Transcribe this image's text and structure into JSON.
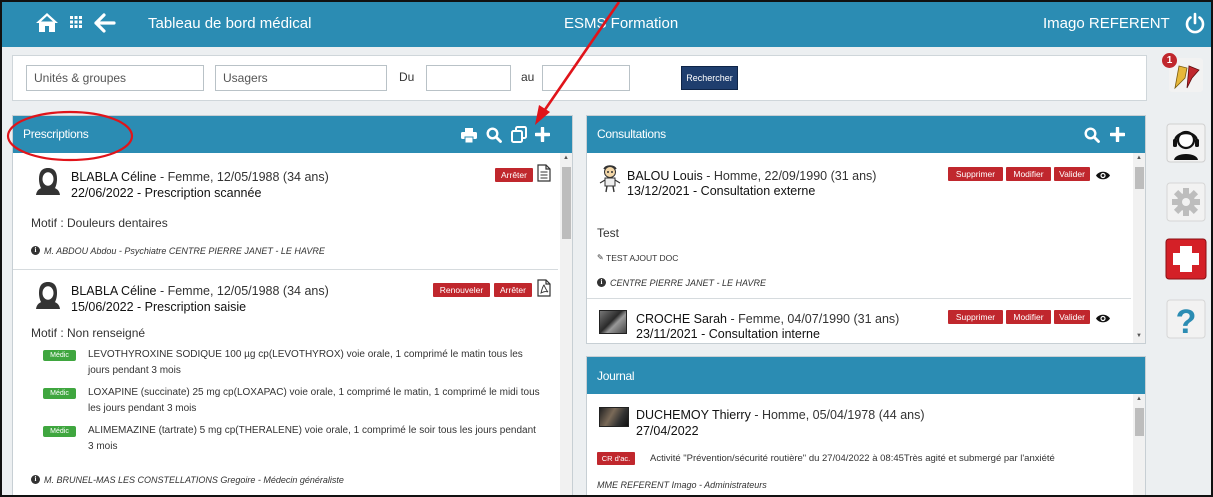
{
  "header": {
    "title": "Tableau de bord médical",
    "org": "ESMS Formation",
    "user": "Imago REFERENT"
  },
  "filters": {
    "units_placeholder": "Unités & groupes",
    "users_placeholder": "Usagers",
    "from_label": "Du",
    "to_label": "au",
    "search_label": "Rechercher"
  },
  "prescriptions": {
    "title": "Prescriptions",
    "entries": [
      {
        "name": "BLABLA Céline",
        "meta": " - Femme, 12/05/1988 (34 ans)",
        "date": "22/06/2022 - Prescription scannée",
        "motif": "Motif : Douleurs dentaires",
        "author": "M. ABDOU Abdou - Psychiatre CENTRE PIERRE JANET - LE HAVRE",
        "stop_label": "Arrêter"
      },
      {
        "name": "BLABLA Céline",
        "meta": " - Femme, 12/05/1988 (34 ans)",
        "date": "15/06/2022 - Prescription saisie",
        "motif": "Motif : Non renseigné",
        "renew_label": "Renouveler",
        "stop_label": "Arrêter",
        "badge": "Médic",
        "meds": [
          "LEVOTHYROXINE SODIQUE 100 µg cp(LEVOTHYROX) voie orale, 1 comprimé le matin tous les jours pendant 3 mois",
          "LOXAPINE (succinate) 25 mg cp(LOXAPAC) voie orale, 1 comprimé le matin, 1 comprimé le midi tous les jours pendant 3 mois",
          "ALIMEMAZINE (tartrate) 5 mg cp(THERALENE) voie orale, 1 comprimé le soir tous les jours pendant 3 mois"
        ],
        "author": "M. BRUNEL-MAS LES CONSTELLATIONS Gregoire - Médecin généraliste"
      }
    ]
  },
  "consultations": {
    "title": "Consultations",
    "delete_label": "Supprimer",
    "edit_label": "Modifier",
    "validate_label": "Valider",
    "entries": [
      {
        "name": "BALOU Louis",
        "meta": " - Homme, 22/09/1990 (31 ans)",
        "date": "13/12/2021 - Consultation externe",
        "text": "Test",
        "doc": "TEST AJOUT DOC",
        "place": "CENTRE PIERRE JANET - LE HAVRE"
      },
      {
        "name": "CROCHE Sarah",
        "meta": " - Femme, 04/07/1990 (31 ans)",
        "date": "23/11/2021 - Consultation interne"
      }
    ]
  },
  "journal": {
    "title": "Journal",
    "entry": {
      "name": "DUCHEMOY Thierry",
      "meta": " - Homme, 05/04/1978 (44 ans)",
      "date": "27/04/2022",
      "badge": "CR d'ac.",
      "text": "Activité \"Prévention/sécurité routière\" du 27/04/2022 à 08:45Très agité et submergé par l'anxiété",
      "author": "MME REFERENT Imago - Administrateurs"
    }
  },
  "sidebar": {
    "notification_count": "1"
  },
  "colors": {
    "header_blue": "#2b8cb3",
    "action_red": "#c0272d",
    "med_green": "#3fa63f",
    "search_navy": "#1f3e6e",
    "annotation_red": "#e0141a"
  },
  "icons": [
    "home-icon",
    "grid-icon",
    "back-arrow-icon",
    "power-icon",
    "print-icon",
    "search-icon",
    "duplicate-icon",
    "plus-icon",
    "document-icon",
    "pdf-icon",
    "eye-icon",
    "notification-flag-icon",
    "support-headset-icon",
    "settings-gear-icon",
    "medical-cross-icon",
    "help-question-icon"
  ]
}
